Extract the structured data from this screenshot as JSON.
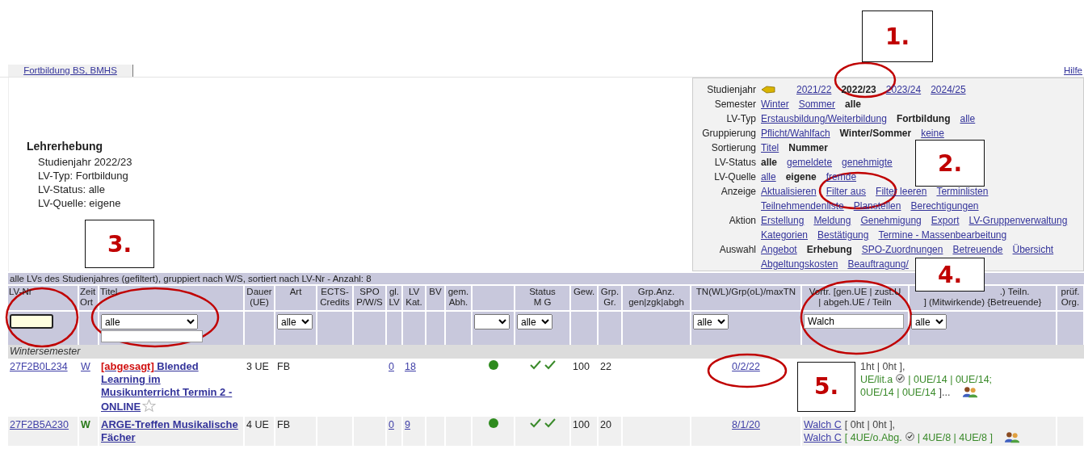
{
  "callouts": [
    {
      "label": "1."
    },
    {
      "label": "2."
    },
    {
      "label": "3."
    },
    {
      "label": "4."
    }
  ],
  "nav": {
    "tab": "Fortbildung BS, BMHS",
    "help": "Hilfe"
  },
  "summary": {
    "title": "Lehrerhebung",
    "lines": [
      "Studienjahr 2022/23",
      "LV-Typ: Fortbildung",
      "LV-Status: alle",
      "LV-Quelle: eigene"
    ]
  },
  "filters": [
    {
      "label": "Studienjahr",
      "pointer": true,
      "options": [
        {
          "text": "2021/22",
          "selected": false
        },
        {
          "text": "2022/23",
          "selected": true
        },
        {
          "text": "2023/24",
          "selected": false
        },
        {
          "text": "2024/25",
          "selected": false
        }
      ]
    },
    {
      "label": "Semester",
      "options": [
        {
          "text": "Winter",
          "selected": false
        },
        {
          "text": "Sommer",
          "selected": false
        },
        {
          "text": "alle",
          "selected": true
        }
      ]
    },
    {
      "label": "LV-Typ",
      "options": [
        {
          "text": "Erstausbildung/Weiterbildung",
          "selected": false
        },
        {
          "text": "Fortbildung",
          "selected": true
        },
        {
          "text": "alle",
          "selected": false
        }
      ]
    },
    {
      "label": "Gruppierung",
      "options": [
        {
          "text": "Pflicht/Wahlfach",
          "selected": false
        },
        {
          "text": "Winter/Sommer",
          "selected": true
        },
        {
          "text": "keine",
          "selected": false
        }
      ]
    },
    {
      "label": "Sortierung",
      "options": [
        {
          "text": "Titel",
          "selected": false
        },
        {
          "text": "Nummer",
          "selected": true
        }
      ]
    },
    {
      "label": "LV-Status",
      "options": [
        {
          "text": "alle",
          "selected": true
        },
        {
          "text": "gemeldete",
          "selected": false
        },
        {
          "text": "genehmigte",
          "selected": false
        }
      ]
    },
    {
      "label": "LV-Quelle",
      "options": [
        {
          "text": "alle",
          "selected": false
        },
        {
          "text": "eigene",
          "selected": true
        },
        {
          "text": "fremde",
          "selected": false
        }
      ]
    },
    {
      "label": "Anzeige",
      "options": [
        {
          "text": "Aktualisieren",
          "selected": false
        },
        {
          "text": "Filter aus",
          "selected": false
        },
        {
          "text": "Filter leeren",
          "selected": false
        },
        {
          "text": "Terminlisten",
          "selected": false
        },
        {
          "text": "Teilnehmendenliste",
          "selected": false
        },
        {
          "text": "Planstellen",
          "selected": false
        },
        {
          "text": "Berechtigungen",
          "selected": false
        }
      ]
    },
    {
      "label": "Aktion",
      "options": [
        {
          "text": "Erstellung",
          "selected": false
        },
        {
          "text": "Meldung",
          "selected": false
        },
        {
          "text": "Genehmigung",
          "selected": false
        },
        {
          "text": "Export",
          "selected": false
        },
        {
          "text": "LV-Gruppenverwaltung",
          "selected": false
        },
        {
          "text": "Kategorien",
          "selected": false
        },
        {
          "text": "Bestätigung",
          "selected": false
        },
        {
          "text": "Termine - Massenbearbeitung",
          "selected": false
        }
      ]
    },
    {
      "label": "Auswahl",
      "options": [
        {
          "text": "Angebot",
          "selected": false
        },
        {
          "text": "Erhebung",
          "selected": true
        },
        {
          "text": "SPO-Zuordnungen",
          "selected": false
        },
        {
          "text": "Betreuende",
          "selected": false
        },
        {
          "text": "Übersicht",
          "selected": false
        },
        {
          "text": "Abgeltungskosten",
          "selected": false
        },
        {
          "text": "Beauftragung/",
          "selected": false
        }
      ]
    }
  ],
  "table": {
    "caption": "alle LVs des Studienjahres (gefiltert), gruppiert nach W/S, sortiert nach LV-Nr - Anzahl: 8",
    "columns": [
      {
        "lines": [
          "LV-Nr"
        ],
        "filter": {
          "kind": "input",
          "focused": true
        }
      },
      {
        "lines": [
          "Zeit",
          "Ort"
        ]
      },
      {
        "lines": [
          "Titel"
        ],
        "filter": {
          "kind": "select_input",
          "value": "alle"
        }
      },
      {
        "lines": [
          "Dauer",
          "(UE)"
        ]
      },
      {
        "lines": [
          "Art"
        ],
        "filter": {
          "kind": "select",
          "value": "alle"
        }
      },
      {
        "lines": [
          "ECTS-",
          "Credits"
        ]
      },
      {
        "lines": [
          "SPO",
          "P/W/S"
        ]
      },
      {
        "lines": [
          "gl.",
          "LV"
        ]
      },
      {
        "lines": [
          "LV",
          "Kat."
        ]
      },
      {
        "lines": [
          "BV"
        ]
      },
      {
        "lines": [
          "gem.",
          "Abh."
        ]
      },
      {
        "filter": {
          "kind": "select"
        }
      },
      {
        "lines": [
          "Status",
          "M   G"
        ],
        "filter": {
          "kind": "select",
          "value": "alle"
        }
      },
      {
        "lines": [
          "Gew."
        ]
      },
      {
        "lines": [
          "Grp.",
          "Gr."
        ]
      },
      {
        "lines": [
          "Grp.Anz.",
          "gen|zgk|abgh"
        ]
      },
      {
        "lines": [
          "TN(WL)/Grp(oL)/maxTN"
        ],
        "filter": {
          "kind": "select",
          "value": "alle"
        }
      },
      {
        "lines": [
          "Vortr. [gen.UE | zust.U",
          "| abgeh.UE / Teiln"
        ],
        "filter": {
          "kind": "input",
          "focused": false,
          "value": "Walch"
        }
      },
      {
        "lines": [
          ".) Teiln.",
          "] (Mitwirkende) {Betreuende}"
        ],
        "filter": {
          "kind": "select",
          "value": "alle"
        }
      },
      {
        "lines": [
          "prüf.",
          "Org."
        ]
      }
    ],
    "group": "Wintersemester",
    "rows": [
      {
        "callout": "5.",
        "cells": [
          {
            "kind": "link",
            "text": "27F2B0L234"
          },
          {
            "kind": "zeit",
            "text": "W",
            "confirmed": false
          },
          {
            "kind": "title",
            "tag": "[abgesagt]",
            "text": "Blended Learning im Musikunterricht Termin 2 - ONLINE",
            "starred": false
          },
          {
            "kind": "text",
            "text": "3 UE"
          },
          {
            "kind": "text",
            "text": "FB"
          },
          null,
          null,
          {
            "kind": "link",
            "text": "0"
          },
          {
            "kind": "link",
            "text": "18"
          },
          null,
          null,
          {
            "kind": "dot",
            "color": "#2e8b1e"
          },
          {
            "kind": "checks",
            "marks": [
              {
                "checked": true
              },
              {
                "checked": true
              }
            ]
          },
          {
            "kind": "text",
            "text": "100"
          },
          {
            "kind": "text",
            "text": "22"
          },
          null,
          {
            "kind": "link",
            "text": "0/2/22"
          },
          {
            "kind": "vortr",
            "lines": [
              [
                {
                  "kind": "plain",
                  "text": "1ht | 0ht ],"
                }
              ],
              [
                {
                  "kind": "green",
                  "text": "UE/lit.a"
                },
                {
                  "kind": "check"
                },
                {
                  "kind": "green",
                  "text": "| 0UE/14 | 0UE/14;"
                }
              ],
              [
                {
                  "kind": "green",
                  "text": "0UE/14 | 0UE/14"
                },
                {
                  "kind": "plain",
                  "text": "]..."
                },
                {
                  "kind": "people"
                }
              ]
            ],
            "colspan": 2
          },
          null
        ]
      },
      {
        "cells": [
          {
            "kind": "link",
            "text": "27F2B5A230"
          },
          {
            "kind": "zeit",
            "text": "W",
            "confirmed": true
          },
          {
            "kind": "title",
            "text": "ARGE-Treffen Musikalische Fächer"
          },
          {
            "kind": "text",
            "text": "4 UE"
          },
          {
            "kind": "text",
            "text": "FB"
          },
          null,
          null,
          {
            "kind": "link",
            "text": "0"
          },
          {
            "kind": "link",
            "text": "9"
          },
          null,
          null,
          {
            "kind": "dot",
            "color": "#2e8b1e"
          },
          {
            "kind": "checks",
            "marks": [
              {
                "checked": true
              },
              {
                "checked": true
              }
            ]
          },
          {
            "kind": "text",
            "text": "100"
          },
          {
            "kind": "text",
            "text": "20"
          },
          null,
          {
            "kind": "link",
            "text": "8/1/20"
          },
          {
            "kind": "vortr",
            "lines": [
              [
                {
                  "kind": "link",
                  "text": "Walch C"
                },
                {
                  "kind": "plain",
                  "text": "[ 0ht | 0ht ],"
                }
              ],
              [
                {
                  "kind": "link",
                  "text": "Walch C"
                },
                {
                  "kind": "green",
                  "text": "[ 4UE/o.Abg."
                },
                {
                  "kind": "check"
                },
                {
                  "kind": "green",
                  "text": "| 4UE/8 | 4UE/8 ]"
                },
                {
                  "kind": "people"
                }
              ]
            ],
            "colspan": 2
          },
          null
        ]
      }
    ]
  }
}
